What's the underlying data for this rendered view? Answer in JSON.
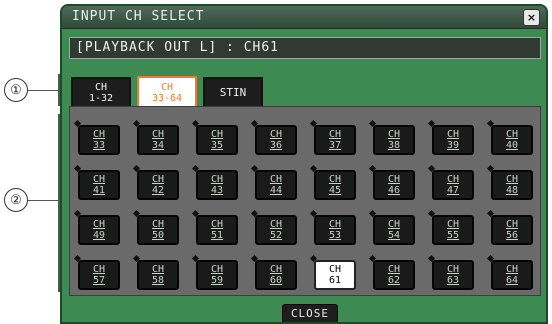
{
  "callouts": {
    "one": "①",
    "two": "②"
  },
  "dialog": {
    "title": "INPUT CH SELECT",
    "close_x": "×",
    "info_line": "[PLAYBACK OUT L] : CH61",
    "close_button": "CLOSE"
  },
  "tabs": [
    {
      "line1": "CH",
      "line2": "1-32",
      "active": false
    },
    {
      "line1": "CH",
      "line2": "33-64",
      "active": true
    },
    {
      "label": "STIN",
      "active": false
    }
  ],
  "channels": [
    {
      "top": "CH",
      "num": "33"
    },
    {
      "top": "CH",
      "num": "34"
    },
    {
      "top": "CH",
      "num": "35"
    },
    {
      "top": "CH",
      "num": "36"
    },
    {
      "top": "CH",
      "num": "37"
    },
    {
      "top": "CH",
      "num": "38"
    },
    {
      "top": "CH",
      "num": "39"
    },
    {
      "top": "CH",
      "num": "40"
    },
    {
      "top": "CH",
      "num": "41"
    },
    {
      "top": "CH",
      "num": "42"
    },
    {
      "top": "CH",
      "num": "43"
    },
    {
      "top": "CH",
      "num": "44"
    },
    {
      "top": "CH",
      "num": "45"
    },
    {
      "top": "CH",
      "num": "46"
    },
    {
      "top": "CH",
      "num": "47"
    },
    {
      "top": "CH",
      "num": "48"
    },
    {
      "top": "CH",
      "num": "49"
    },
    {
      "top": "CH",
      "num": "50"
    },
    {
      "top": "CH",
      "num": "51"
    },
    {
      "top": "CH",
      "num": "52"
    },
    {
      "top": "CH",
      "num": "53"
    },
    {
      "top": "CH",
      "num": "54"
    },
    {
      "top": "CH",
      "num": "55"
    },
    {
      "top": "CH",
      "num": "56"
    },
    {
      "top": "CH",
      "num": "57"
    },
    {
      "top": "CH",
      "num": "58"
    },
    {
      "top": "CH",
      "num": "59"
    },
    {
      "top": "CH",
      "num": "60"
    },
    {
      "top": "CH",
      "num": "61",
      "selected": true
    },
    {
      "top": "CH",
      "num": "62"
    },
    {
      "top": "CH",
      "num": "63"
    },
    {
      "top": "CH",
      "num": "64"
    }
  ],
  "colors": {
    "panel_bg": "#3d8a52",
    "active_tab": "#f07a2c",
    "button_bg": "#1a1a1a"
  }
}
